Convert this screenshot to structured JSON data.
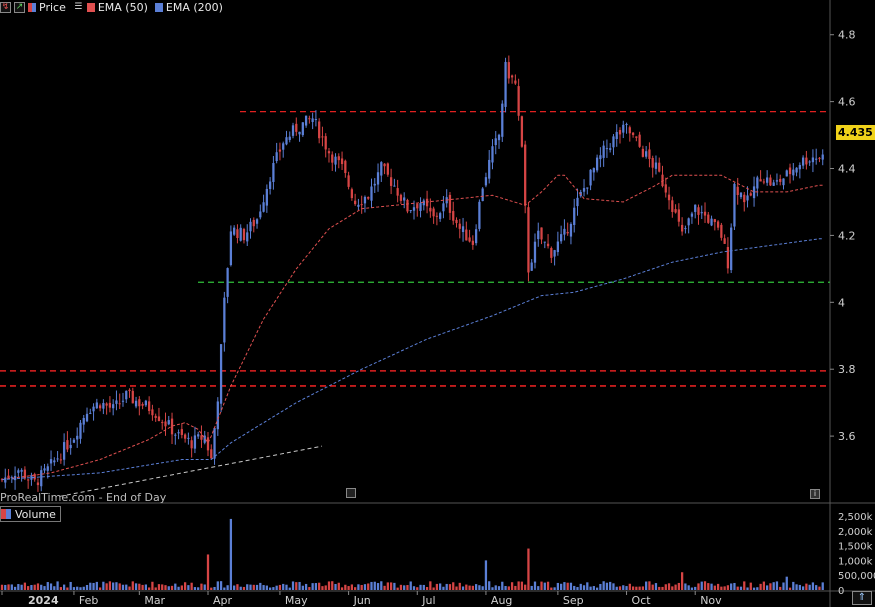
{
  "legend": {
    "price_label": "Price",
    "ema50_label": "EMA (50)",
    "ema200_label": "EMA (200)",
    "colors": {
      "ema50": "#e05050",
      "ema200": "#5b7fd6"
    }
  },
  "source_text": "ProRealTime.com - End of Day",
  "last_price": "4.435",
  "volume_label": "Volume",
  "colors": {
    "up": "#5b7fd6",
    "down": "#d64545",
    "support": "#2fbf3a",
    "resistance": "#e02020",
    "trend": "#c8c8c8",
    "background": "#000000",
    "price_tag": "#f0d21a"
  },
  "chart_data": {
    "type": "candlestick",
    "xlabel": "",
    "ylabel": "",
    "ylim": [
      3.4,
      4.85
    ],
    "yticks": [
      "4.8",
      "4.6",
      "4.4",
      "4.2",
      "4",
      "3.8",
      "3.6"
    ],
    "xticks": [
      "2024",
      "Feb",
      "Mar",
      "Apr",
      "May",
      "Jun",
      "Jul",
      "Aug",
      "Sep",
      "Oct",
      "Nov"
    ],
    "volume_ticks": [
      "2,500k",
      "2,000k",
      "1,500k",
      "1,000k",
      "500,000",
      "0"
    ],
    "volume_max": 2600,
    "horizontal_levels": [
      {
        "value": 4.57,
        "style": "dashed",
        "color": "red",
        "from_month": "Apr"
      },
      {
        "value": 4.06,
        "style": "dashed",
        "color": "green",
        "from_month": "Mar"
      },
      {
        "value": 3.795,
        "style": "dashed",
        "color": "red",
        "from_month": "2024"
      },
      {
        "value": 3.75,
        "style": "dashed",
        "color": "red",
        "from_month": "2024"
      }
    ],
    "trendline": {
      "from": [
        "2024",
        3.42
      ],
      "to": [
        "May",
        3.57
      ]
    },
    "ema50": [
      [
        0,
        3.47
      ],
      [
        15,
        3.49
      ],
      [
        30,
        3.53
      ],
      [
        45,
        3.59
      ],
      [
        52,
        3.63
      ],
      [
        56,
        3.64
      ],
      [
        60,
        3.62
      ],
      [
        63,
        3.58
      ],
      [
        64,
        3.6
      ],
      [
        70,
        3.75
      ],
      [
        80,
        3.95
      ],
      [
        90,
        4.1
      ],
      [
        100,
        4.22
      ],
      [
        110,
        4.28
      ],
      [
        120,
        4.29
      ],
      [
        130,
        4.3
      ],
      [
        140,
        4.31
      ],
      [
        150,
        4.32
      ],
      [
        160,
        4.29
      ],
      [
        165,
        4.33
      ],
      [
        170,
        4.38
      ],
      [
        172,
        4.38
      ],
      [
        178,
        4.31
      ],
      [
        190,
        4.3
      ],
      [
        200,
        4.35
      ],
      [
        205,
        4.38
      ],
      [
        210,
        4.38
      ],
      [
        220,
        4.38
      ],
      [
        230,
        4.33
      ],
      [
        240,
        4.33
      ],
      [
        250,
        4.35
      ]
    ],
    "ema200": [
      [
        0,
        3.47
      ],
      [
        30,
        3.49
      ],
      [
        55,
        3.53
      ],
      [
        64,
        3.53
      ],
      [
        70,
        3.58
      ],
      [
        90,
        3.7
      ],
      [
        110,
        3.8
      ],
      [
        130,
        3.89
      ],
      [
        150,
        3.96
      ],
      [
        165,
        4.02
      ],
      [
        175,
        4.03
      ],
      [
        190,
        4.07
      ],
      [
        205,
        4.12
      ],
      [
        220,
        4.15
      ],
      [
        235,
        4.17
      ],
      [
        250,
        4.19
      ]
    ],
    "tick_days": [
      0,
      22,
      42,
      63,
      85,
      106,
      127,
      148,
      170,
      191,
      212
    ],
    "total_days": 252,
    "volume_spikes": [
      [
        63,
        1200
      ],
      [
        70,
        2400
      ],
      [
        161,
        1400
      ],
      [
        148,
        1000
      ],
      [
        208,
        600
      ],
      [
        240,
        450
      ]
    ]
  }
}
